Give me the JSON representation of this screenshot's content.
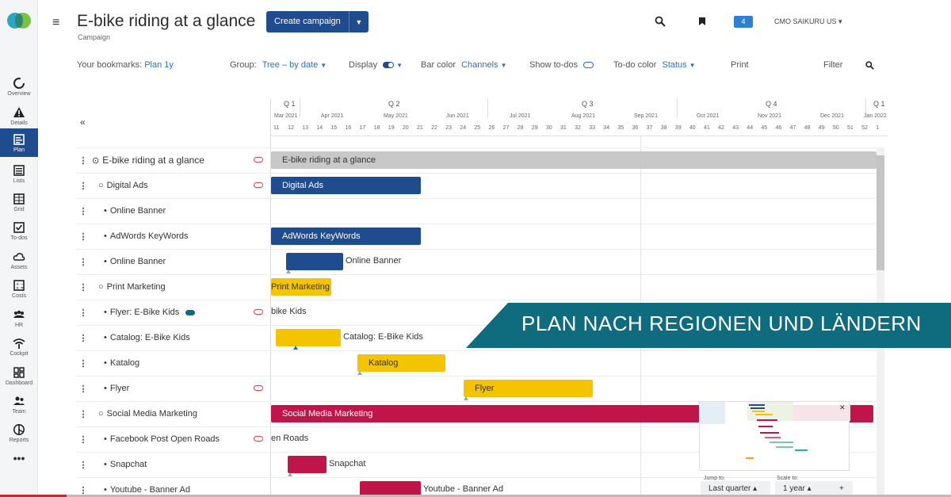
{
  "header": {
    "title": "E-bike riding at a glance",
    "subtitle": "Campaign",
    "create_label": "Create campaign",
    "badge_count": "4",
    "user": "CMO SAIKURU US"
  },
  "nav": [
    {
      "label": "Overview",
      "icon": "overview-icon"
    },
    {
      "label": "Details",
      "icon": "warning-icon"
    },
    {
      "label": "Plan",
      "icon": "plan-icon"
    },
    {
      "label": "Lists",
      "icon": "list-icon"
    },
    {
      "label": "Grid",
      "icon": "grid-icon"
    },
    {
      "label": "To-dos",
      "icon": "checkbox-icon"
    },
    {
      "label": "Assets",
      "icon": "cloud-icon"
    },
    {
      "label": "Costs",
      "icon": "calculator-icon"
    },
    {
      "label": "HR",
      "icon": "people-icon"
    },
    {
      "label": "Cockpit",
      "icon": "wifi-icon"
    },
    {
      "label": "Dashboard",
      "icon": "dashboard-icon"
    },
    {
      "label": "Team",
      "icon": "team-icon"
    },
    {
      "label": "Reports",
      "icon": "reports-icon"
    }
  ],
  "toolbar": {
    "bookmarks_label": "Your bookmarks:",
    "bookmarks_value": "Plan 1y",
    "group_label": "Group:",
    "group_value": "Tree – by date",
    "display_label": "Display",
    "bar_color_label": "Bar color",
    "bar_color_value": "Channels",
    "show_todos_label": "Show to-dos",
    "todo_color_label": "To-do color",
    "todo_color_value": "Status",
    "print_label": "Print",
    "filter_label": "Filter"
  },
  "timeline": {
    "quarters": [
      "Q 1",
      "Q 2",
      "Q 3",
      "Q 4",
      "Q 1"
    ],
    "months": [
      "Mar 2021",
      "Apr 2021",
      "May 2021",
      "Jun 2021",
      "Jul 2021",
      "Aug 2021",
      "Sep 2021",
      "Oct 2021",
      "Nov 2021",
      "Dec 2021",
      "Jan 2022"
    ],
    "weeks": [
      "11",
      "12",
      "13",
      "14",
      "15",
      "16",
      "17",
      "18",
      "19",
      "20",
      "21",
      "22",
      "23",
      "24",
      "25",
      "26",
      "27",
      "28",
      "29",
      "30",
      "31",
      "32",
      "33",
      "34",
      "35",
      "36",
      "37",
      "38",
      "39",
      "40",
      "41",
      "42",
      "43",
      "44",
      "45",
      "46",
      "47",
      "48",
      "49",
      "50",
      "51",
      "52",
      "1"
    ]
  },
  "rows": [
    {
      "label": "E-bike riding at a glance",
      "level": 0,
      "bar": "E-bike riding at a glance",
      "color": "#c8c8c8"
    },
    {
      "label": "Digital Ads",
      "level": 1,
      "bar": "Digital Ads",
      "color": "#1f4b8f"
    },
    {
      "label": "Online Banner",
      "level": 2,
      "bar": "",
      "color": ""
    },
    {
      "label": "AdWords KeyWords",
      "level": 2,
      "bar": "AdWords KeyWords",
      "color": "#1f4b8f"
    },
    {
      "label": "Online Banner",
      "level": 2,
      "bar": "Online Banner",
      "color": "#1f4b8f"
    },
    {
      "label": "Print Marketing",
      "level": 1,
      "bar": "Print Marketing",
      "color": "#f5c400"
    },
    {
      "label": "Flyer: E-Bike Kids",
      "level": 2,
      "bar": "bike Kids",
      "color": ""
    },
    {
      "label": "Catalog: E-Bike Kids",
      "level": 2,
      "bar": "Catalog: E-Bike Kids",
      "color": "#f5c400"
    },
    {
      "label": "Katalog",
      "level": 2,
      "bar": "Katalog",
      "color": "#f5c400"
    },
    {
      "label": "Flyer",
      "level": 2,
      "bar": "Flyer",
      "color": "#f5c400"
    },
    {
      "label": "Social Media Marketing",
      "level": 1,
      "bar": "Social Media Marketing",
      "color": "#c0154b"
    },
    {
      "label": "Facebook Post Open Roads",
      "level": 2,
      "bar": "en Roads",
      "color": ""
    },
    {
      "label": "Snapchat",
      "level": 2,
      "bar": "Snapchat",
      "color": "#c0154b"
    },
    {
      "label": "Youtube - Banner Ad",
      "level": 2,
      "bar": "Youtube - Banner Ad",
      "color": "#c0154b"
    }
  ],
  "banner": "PLAN NACH REGIONEN UND LÄNDERN",
  "footer": {
    "jump_label": "Jump to:",
    "jump_value": "Last quarter",
    "scale_label": "Scale to:",
    "scale_value": "1 year"
  }
}
